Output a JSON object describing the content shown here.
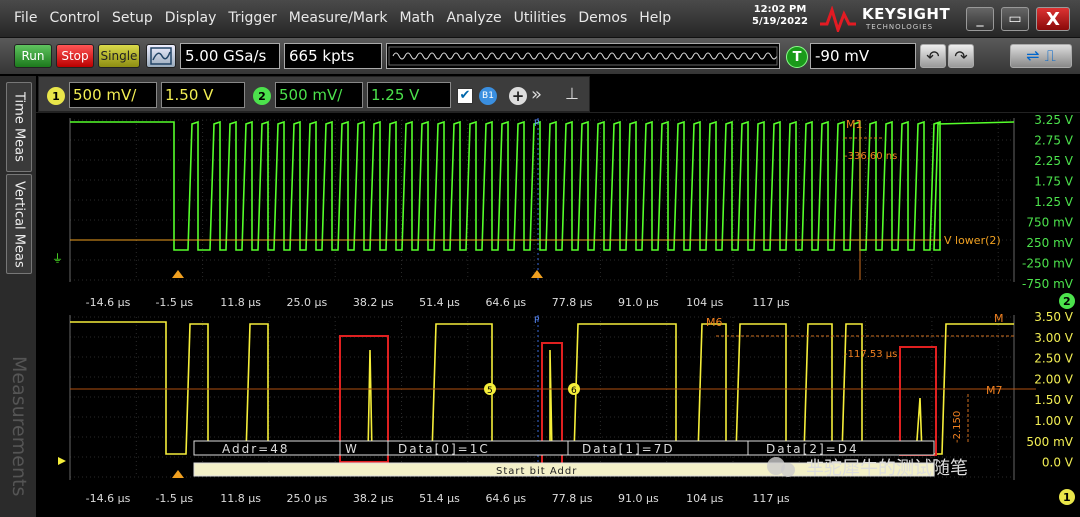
{
  "menu": {
    "items": [
      "File",
      "Control",
      "Setup",
      "Display",
      "Trigger",
      "Measure/Mark",
      "Math",
      "Analyze",
      "Utilities",
      "Demos",
      "Help"
    ]
  },
  "clock": {
    "time": "12:02 PM",
    "date": "5/19/2022"
  },
  "brand": {
    "name": "KEYSIGHT",
    "sub": "TECHNOLOGIES"
  },
  "window": {
    "minimize": "_",
    "maximize": "▭",
    "close": "X"
  },
  "toolbar": {
    "run": "Run",
    "stop": "Stop",
    "single": "Single",
    "sample_rate": "5.00 GSa/s",
    "memory_depth": "665 kpts",
    "trigger_badge": "T",
    "trigger_level": "-90 mV"
  },
  "channels": {
    "ch1": {
      "badge": "1",
      "scale": "500 mV/",
      "offset": "1.50 V",
      "color": "#f2ee54"
    },
    "ch2": {
      "badge": "2",
      "scale": "500 mV/",
      "offset": "1.25 V",
      "color": "#4ce24c"
    },
    "bus_badge": "B1"
  },
  "side_tabs": {
    "time_meas": "Time Meas",
    "vertical_meas": "Vertical Meas",
    "measurements": "Measurements"
  },
  "time_ticks": [
    "-14.6 µs",
    "-1.5 µs",
    "11.8 µs",
    "25.0 µs",
    "38.2 µs",
    "51.4 µs",
    "64.6 µs",
    "77.8 µs",
    "91.0 µs",
    "104 µs",
    "117 µs"
  ],
  "upper": {
    "volt_ticks": [
      "3.25 V",
      "2.75 V",
      "2.25 V",
      "1.75 V",
      "1.25 V",
      "750 mV",
      "250 mV",
      "-250 mV",
      "-750 mV"
    ],
    "marker_label": "M1",
    "marker_delta": "-336.60 ns",
    "vlower_label": "V lower(2)",
    "channel_badge": "2"
  },
  "lower": {
    "volt_ticks": [
      "3.50 V",
      "3.00 V",
      "2.50 V",
      "2.00 V",
      "1.50 V",
      "1.00 V",
      "500 mV",
      "0.0 V"
    ],
    "m6_label": "M6",
    "m7_label": "M7",
    "delta_label": "-117.53 µs",
    "vert_label": "-2.150",
    "edge_badges": [
      "5",
      "6"
    ],
    "channel_badge": "1",
    "bus_segments": [
      "Addr=48",
      "W",
      "Data[0]=1C",
      "Data[1]=7D",
      "Data[2]=D4"
    ],
    "bus_row2": "Start   bit Addr",
    "watermark": "芈驼犀牛的测试随笔",
    "edge_marker": "M"
  }
}
